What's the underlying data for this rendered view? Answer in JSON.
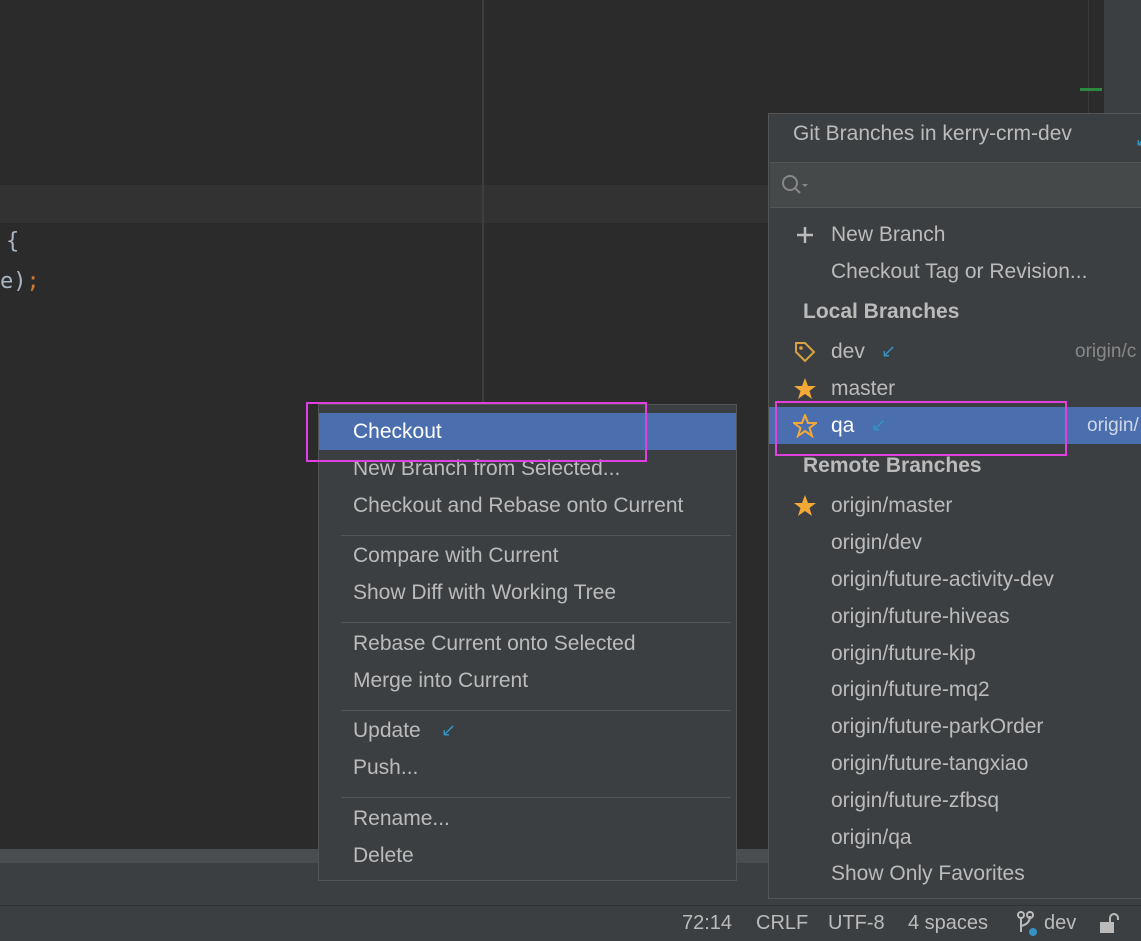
{
  "editor": {
    "code_line_1": "{",
    "code_line_2_text": "e)",
    "code_line_2_semicolon": ";"
  },
  "branches_popup": {
    "title": "Git Branches in kerry-crm-dev",
    "search_value": "",
    "actions": [
      {
        "label": "New Branch",
        "icon": "plus-icon"
      },
      {
        "label": "Checkout Tag or Revision...",
        "icon": ""
      }
    ],
    "local_header": "Local Branches",
    "local_branches": [
      {
        "name": "dev",
        "icon": "tag-icon",
        "tracking": "origin/c",
        "incoming": true
      },
      {
        "name": "master",
        "icon": "star-filled-icon",
        "tracking": "",
        "incoming": false
      },
      {
        "name": "qa",
        "icon": "star-outline-icon",
        "tracking": "origin/",
        "incoming": true,
        "selected": true
      }
    ],
    "remote_header": "Remote Branches",
    "remote_branches": [
      {
        "name": "origin/master",
        "icon": "star-filled-icon"
      },
      {
        "name": "origin/dev"
      },
      {
        "name": "origin/future-activity-dev"
      },
      {
        "name": "origin/future-hiveas"
      },
      {
        "name": "origin/future-kip"
      },
      {
        "name": "origin/future-mq2"
      },
      {
        "name": "origin/future-parkOrder"
      },
      {
        "name": "origin/future-tangxiao"
      },
      {
        "name": "origin/future-zfbsq"
      },
      {
        "name": "origin/qa"
      }
    ],
    "footer_item": "Show Only Favorites"
  },
  "context_menu": {
    "items": [
      {
        "label": "Checkout",
        "selected": true
      },
      {
        "label": "New Branch from Selected..."
      },
      {
        "label": "Checkout and Rebase onto Current"
      },
      {
        "label": "Compare with Current"
      },
      {
        "label": "Show Diff with Working Tree"
      },
      {
        "label": "Rebase Current onto Selected"
      },
      {
        "label": "Merge into Current"
      },
      {
        "label": "Update",
        "incoming": true
      },
      {
        "label": "Push..."
      },
      {
        "label": "Rename..."
      },
      {
        "label": "Delete"
      }
    ]
  },
  "status_bar": {
    "position": "72:14",
    "line_separator": "CRLF",
    "encoding": "UTF-8",
    "indent": "4 spaces",
    "branch": "dev",
    "lock_icon": "unlocked-icon"
  },
  "colors": {
    "accent_selection": "#4b6eaf",
    "highlight_annotation": "#e040e0",
    "star": "#f4a836",
    "incoming_arrow": "#3592c4"
  }
}
